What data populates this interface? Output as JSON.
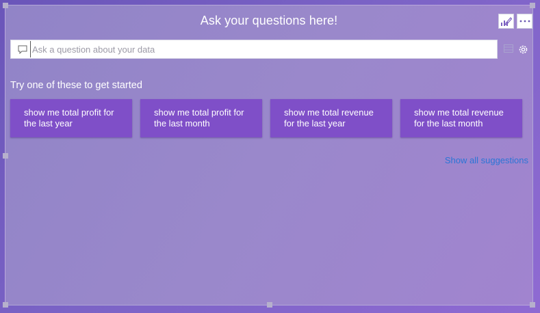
{
  "visual": {
    "title": "Ask your questions here!",
    "edit_button_icon": "edit-chart-icon",
    "more_button_icon": "more-options-icon"
  },
  "search": {
    "icon": "chat-icon",
    "placeholder": "Ask a question about your data",
    "value": ""
  },
  "side_icons": [
    "table-icon",
    "gear-icon"
  ],
  "suggestions_section": {
    "heading": "Try one of these to get started",
    "items": [
      {
        "label": "show me total profit for the last year"
      },
      {
        "label": "show me total profit for the last month"
      },
      {
        "label": "show me total revenue for the last year"
      },
      {
        "label": "show me total revenue for the last month"
      }
    ],
    "show_all_label": "Show all suggestions"
  },
  "colors": {
    "background": "#7b63c6",
    "panel": "#9a88cb",
    "suggestion_button": "#7f4fc8",
    "link": "#2a75d6"
  }
}
